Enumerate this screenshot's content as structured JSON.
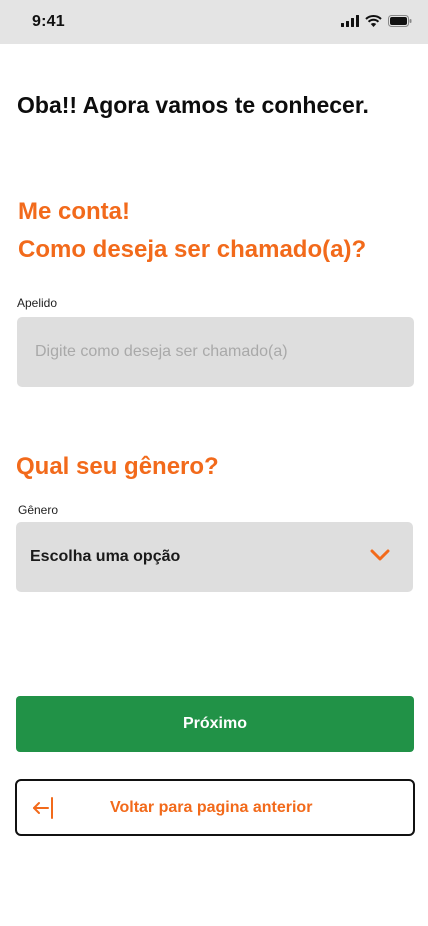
{
  "status_bar": {
    "time": "9:41"
  },
  "page": {
    "heading": "Oba!! Agora vamos te conhecer."
  },
  "nickname_section": {
    "title_line1": "Me conta!",
    "title_line2": "Como deseja ser chamado(a)?",
    "field_label": "Apelido",
    "placeholder": "Digite como deseja ser chamado(a)",
    "value": ""
  },
  "gender_section": {
    "title": "Qual seu gênero?",
    "field_label": "Gênero",
    "selected_value": "Escolha uma opção"
  },
  "actions": {
    "next_label": "Próximo",
    "back_label": "Voltar para pagina anterior"
  },
  "colors": {
    "accent": "#f26a1b",
    "primary_button": "#219247",
    "field_background": "#dedede",
    "status_bar": "#e4e4e4"
  },
  "icons": {
    "signal": "signal-icon",
    "wifi": "wifi-icon",
    "battery": "battery-icon",
    "dropdown": "chevron-down-icon",
    "back": "arrow-left-icon"
  }
}
